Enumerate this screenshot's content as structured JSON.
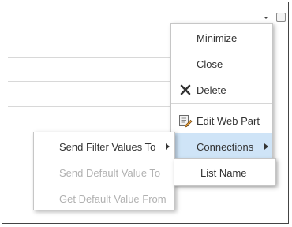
{
  "main_menu": {
    "items": [
      {
        "label": "Minimize"
      },
      {
        "label": "Close"
      },
      {
        "label": "Delete",
        "icon": "delete-x-icon"
      },
      {
        "label": "Edit Web Part",
        "icon": "edit-web-part-icon"
      },
      {
        "label": "Connections",
        "highlighted": true
      }
    ]
  },
  "connections_submenu": {
    "items": [
      {
        "label": "Send Filter Values To",
        "enabled": true
      },
      {
        "label": "Send Default Value To",
        "enabled": false
      },
      {
        "label": "Get Default Value From",
        "enabled": false
      }
    ]
  },
  "filter_targets_submenu": {
    "items": [
      {
        "label": "List Name"
      }
    ]
  },
  "colors": {
    "highlight": "#cfe4f7",
    "text": "#333333",
    "disabled_text": "#b1b1b1",
    "icon_red": "#c0392b"
  }
}
